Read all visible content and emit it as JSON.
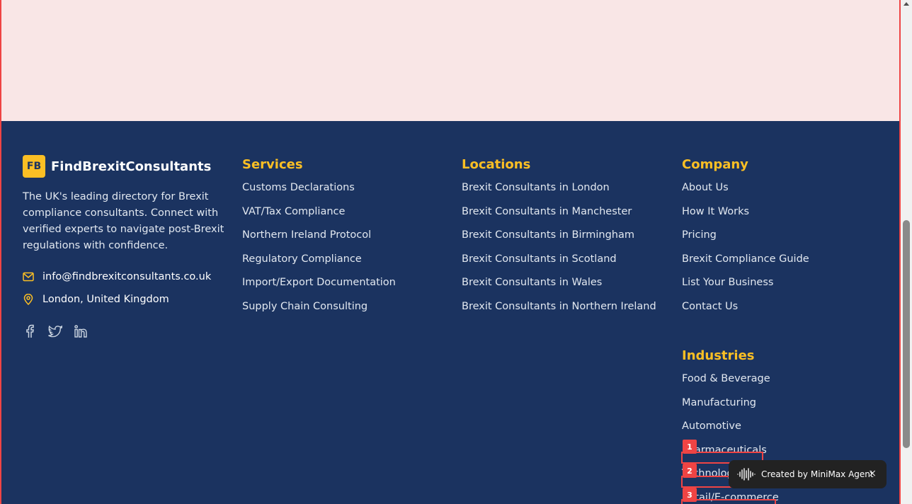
{
  "brand": {
    "logo": "FB",
    "name": "FindBrexitConsultants"
  },
  "about": "The UK's leading directory for Brexit compliance consultants. Connect with verified experts to navigate post-Brexit regulations with confidence.",
  "contact": {
    "email": "info@findbrexitconsultants.co.uk",
    "location": "London, United Kingdom"
  },
  "socials": [
    "facebook-icon",
    "twitter-icon",
    "linkedin-icon"
  ],
  "services": {
    "title": "Services",
    "items": [
      "Customs Declarations",
      "VAT/Tax Compliance",
      "Northern Ireland Protocol",
      "Regulatory Compliance",
      "Import/Export Documentation",
      "Supply Chain Consulting"
    ]
  },
  "locations": {
    "title": "Locations",
    "items": [
      "Brexit Consultants in London",
      "Brexit Consultants in Manchester",
      "Brexit Consultants in Birmingham",
      "Brexit Consultants in Scotland",
      "Brexit Consultants in Wales",
      "Brexit Consultants in Northern Ireland"
    ]
  },
  "company": {
    "title": "Company",
    "items": [
      "About Us",
      "How It Works",
      "Pricing",
      "Brexit Compliance Guide",
      "List Your Business",
      "Contact Us"
    ]
  },
  "industries": {
    "title": "Industries",
    "items": [
      "Food & Beverage",
      "Manufacturing",
      "Automotive",
      "Pharmaceuticals",
      "Technolog",
      "Retail/E-commerce"
    ]
  },
  "highlights": [
    "1",
    "2",
    "3"
  ],
  "agent_badge": {
    "label": "Created by MiniMax Agent",
    "close": "×"
  },
  "colors": {
    "footer_bg": "#1b3360",
    "accent": "#fbbf24",
    "top_bg": "#f9e6e6",
    "highlight": "#ef4444"
  }
}
